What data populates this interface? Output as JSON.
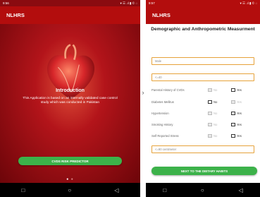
{
  "left": {
    "status_time": "9:56",
    "status_right": "▾ ☰ .ıl ▮ © ◌",
    "app_title": "NLHRS",
    "intro_title": "Introduction",
    "intro_text": "This Application is based on an internally validated case control study which was conducted in Pakistan",
    "predict_button": "CVDS RISK PREDICTOR",
    "page_dots": [
      "●",
      "●"
    ],
    "nav": [
      "□",
      "○",
      "◁"
    ]
  },
  "right": {
    "status_time": "9:57",
    "status_right": "▾ ☰ .ıl ▮ © ◌",
    "app_title": "NLHRS",
    "form_title": "Demographic and Anthropometric Measurment",
    "gender_value": "Male",
    "age_value": "<=40",
    "questions": [
      {
        "label": "Parental History of CVDs",
        "no_label": "No",
        "yes_label": "Yes"
      },
      {
        "label": "Diabetes Mellitus",
        "no_label": "No",
        "yes_label": "Yes"
      },
      {
        "label": "Hypertension",
        "no_label": "No",
        "yes_label": "Yes"
      },
      {
        "label": "Smoking History",
        "no_label": "No",
        "yes_label": "Yes"
      },
      {
        "label": "Self Reported Stress",
        "no_label": "No",
        "yes_label": "Yes"
      }
    ],
    "waist_value": "<=90 centimeter",
    "next_button": "NEXT TO THE DIETARY HABITS",
    "nav": [
      "□",
      "○",
      "◁"
    ]
  },
  "divider_arrow": "›"
}
